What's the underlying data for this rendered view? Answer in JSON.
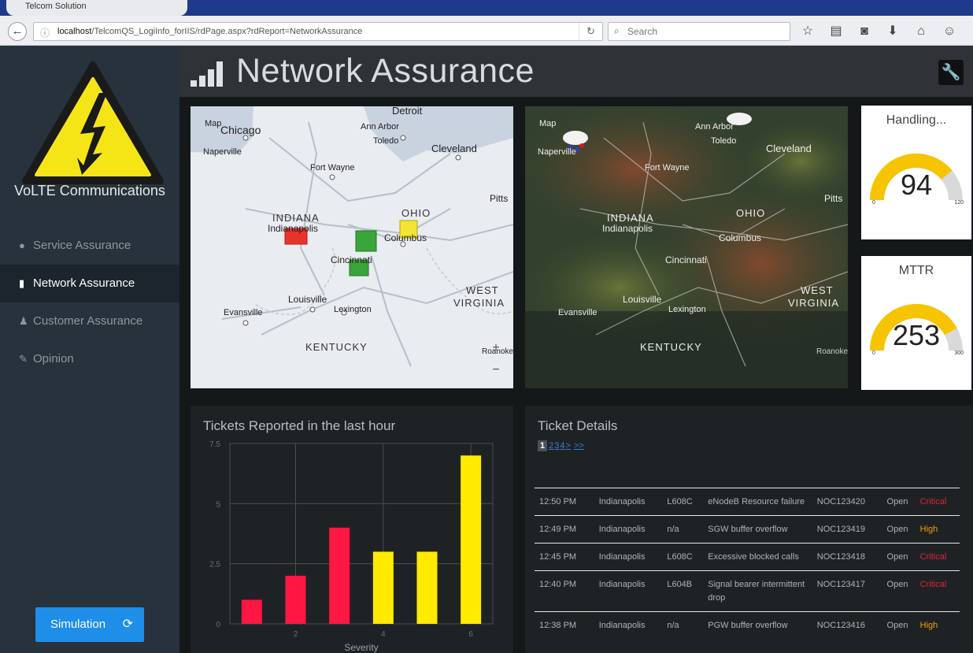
{
  "browser": {
    "tab_title": "Telcom Solution",
    "url_host": "localhost",
    "url_path": "/TelcomQS_LogiInfo_forIIS/rdPage.aspx?rdReport=NetworkAssurance",
    "search_placeholder": "Search"
  },
  "sidebar": {
    "brand": "VoLTE Communications",
    "items": [
      {
        "label": "Service Assurance",
        "icon": "globe-icon",
        "glyph": "●"
      },
      {
        "label": "Network Assurance",
        "icon": "signal-bars-icon",
        "glyph": "▮"
      },
      {
        "label": "Customer Assurance",
        "icon": "user-icon",
        "glyph": "♟"
      },
      {
        "label": "Opinion",
        "icon": "chat-icon",
        "glyph": "✎"
      }
    ],
    "simulation_button": "Simulation"
  },
  "header": {
    "title": "Network Assurance"
  },
  "map_left": {
    "label": "Map",
    "places": [
      "Chicago",
      "Ann Arbor",
      "Detroit",
      "Toledo",
      "Cleveland",
      "Naperville",
      "Fort Wayne",
      "Pitts",
      "INDIANA",
      "Indianapolis",
      "OHIO",
      "Columbus",
      "Cincinnati",
      "WEST",
      "VIRGINIA",
      "Louisville",
      "Lexington",
      "Evansville",
      "KENTUCKY",
      "Roanoke"
    ],
    "zoom_in": "+",
    "zoom_out": "−",
    "markers": [
      {
        "status": "critical",
        "color": "#e8322c"
      },
      {
        "status": "warning",
        "color": "#f3e533"
      },
      {
        "status": "ok",
        "color": "#3aa53a"
      },
      {
        "status": "ok",
        "color": "#3aa53a"
      }
    ]
  },
  "map_right": {
    "label": "Map",
    "places": [
      "Ann Arbor",
      "Toledo",
      "Cleveland",
      "Naperville",
      "Fort Wayne",
      "Pitts",
      "INDIANA",
      "Indianapolis",
      "OHIO",
      "Columbus",
      "Cincinnati",
      "WEST",
      "VIRGINIA",
      "Louisville",
      "Lexington",
      "Evansville",
      "KENTUCKY",
      "Roanoke"
    ]
  },
  "gauges": [
    {
      "title": "Handling...",
      "value": "94",
      "min": "0",
      "max": "120",
      "fraction": 0.78,
      "color": "#f6c400"
    },
    {
      "title": "MTTR",
      "value": "253",
      "min": "0",
      "max": "300",
      "fraction": 0.84,
      "color": "#f6c400"
    }
  ],
  "tickets_chart": {
    "title": "Tickets Reported in the last hour"
  },
  "chart_data": {
    "type": "bar",
    "title": "Tickets Reported in the last hour",
    "xlabel": "Severity",
    "ylabel": "",
    "x": [
      1,
      2,
      3,
      4,
      5,
      6
    ],
    "values": [
      1,
      2,
      4,
      3,
      3,
      7
    ],
    "colors": [
      "#ff1744",
      "#ff1744",
      "#ff1744",
      "#ffea00",
      "#ffea00",
      "#ffea00"
    ],
    "xticks": [
      "2",
      "4",
      "6"
    ],
    "yticks": [
      "0",
      "2.5",
      "5",
      "7.5"
    ],
    "ylim": [
      0,
      7.5
    ],
    "xlim": [
      0.5,
      6.5
    ],
    "grid": true
  },
  "ticket_details": {
    "title": "Ticket Details",
    "pager": {
      "current": "1",
      "pages": [
        "2",
        "3",
        "4"
      ],
      "next": ">",
      "last": ">>"
    },
    "rows": [
      {
        "time": "12:50 PM",
        "city": "Indianapolis",
        "site": "L608C",
        "desc": "eNodeB Resource failure",
        "ticket": "NOC123420",
        "status": "Open",
        "severity": "Critical"
      },
      {
        "time": "12:49 PM",
        "city": "Indianapolis",
        "site": "n/a",
        "desc": "SGW buffer overflow",
        "ticket": "NOC123419",
        "status": "Open",
        "severity": "High"
      },
      {
        "time": "12:45 PM",
        "city": "Indianapolis",
        "site": "L608C",
        "desc": "Excessive blocked calls",
        "ticket": "NOC123418",
        "status": "Open",
        "severity": "Critical"
      },
      {
        "time": "12:40 PM",
        "city": "Indianapolis",
        "site": "L604B",
        "desc": "Signal bearer intermittent drop",
        "ticket": "NOC123417",
        "status": "Open",
        "severity": "Critical"
      },
      {
        "time": "12:38 PM",
        "city": "Indianapolis",
        "site": "n/a",
        "desc": "PGW buffer overflow",
        "ticket": "NOC123416",
        "status": "Open",
        "severity": "High"
      }
    ]
  }
}
